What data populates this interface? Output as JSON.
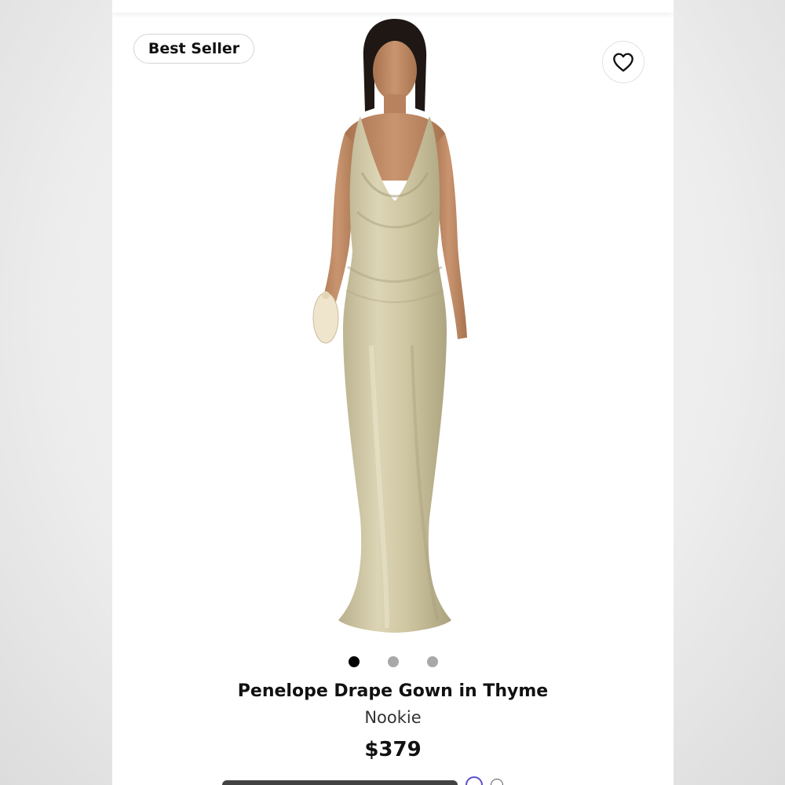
{
  "product": {
    "badge": "Best Seller",
    "title": "Penelope Drape Gown in Thyme",
    "brand": "Nookie",
    "price": "$379"
  },
  "gallery": {
    "image_count": 3,
    "active_index": 0
  },
  "colors": {
    "gown": "#cfc6a2",
    "gown_shadow": "#a9a07c",
    "skin": "#c08a66",
    "active_dot": "#000000",
    "inactive_dot": "#a8a8a8",
    "afterpay_accent": "#5b4ed1"
  },
  "icons": {
    "wishlist": "heart-outline-icon",
    "info": "info-icon"
  }
}
